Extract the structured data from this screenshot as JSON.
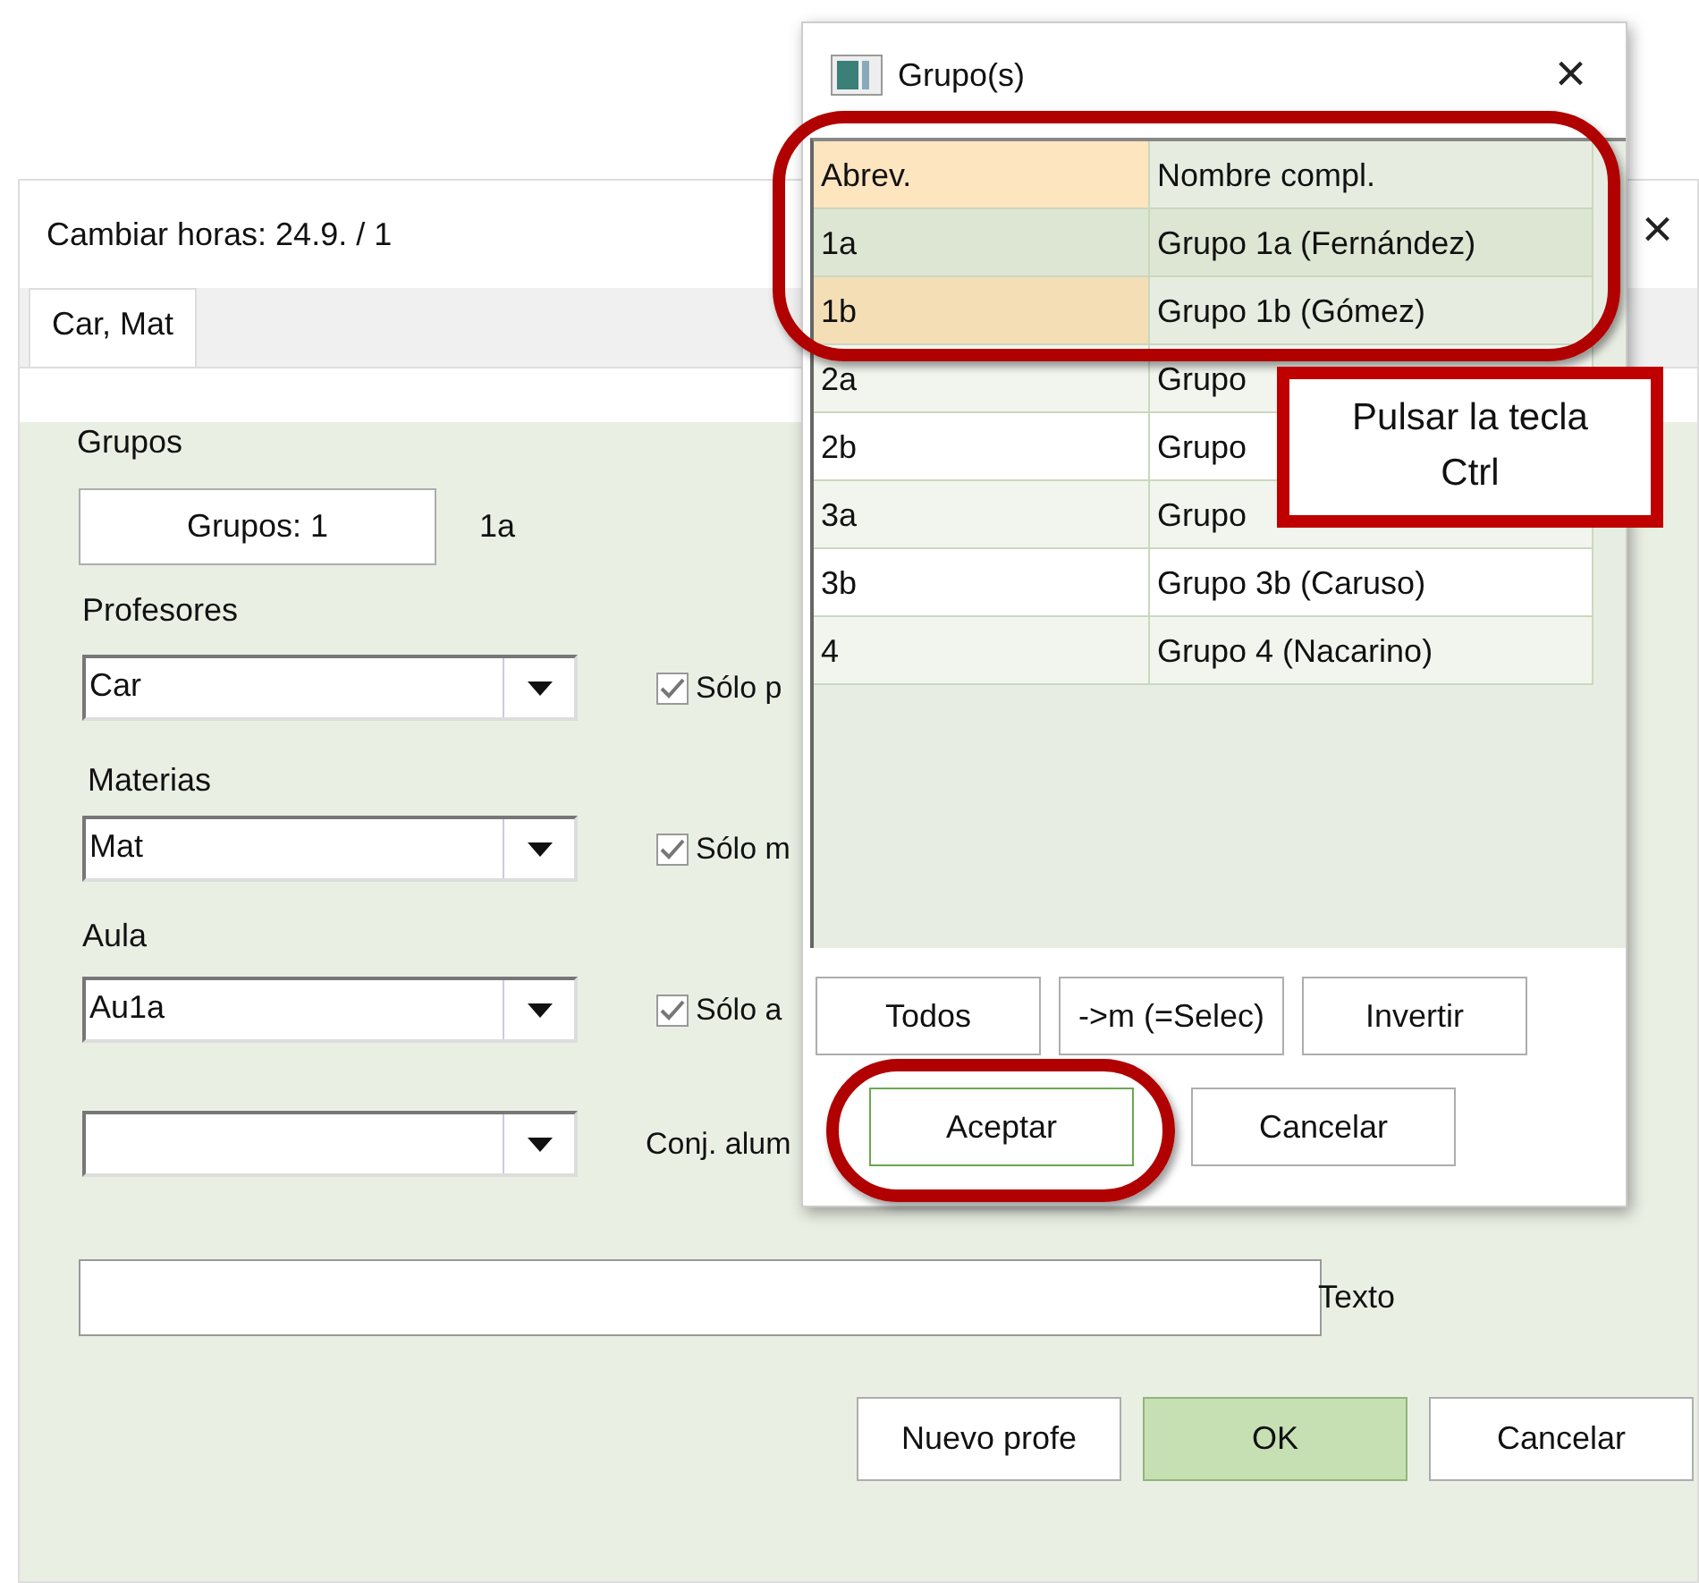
{
  "main_dialog": {
    "title": "Cambiar horas:  24.9. / 1",
    "close": "×",
    "tabs": [
      {
        "label": "Car, Mat",
        "selected": true
      }
    ],
    "groups": {
      "label": "Grupos",
      "button": "Grupos: 1",
      "value": "1a"
    },
    "fields": [
      {
        "label": "Profesores",
        "value": "Car",
        "check": {
          "label": "Sólo p",
          "checked": true
        }
      },
      {
        "label": "Materias",
        "value": "Mat",
        "check": {
          "label": "Sólo m",
          "checked": true
        }
      },
      {
        "label": "Aula",
        "value": "Au1a",
        "check": {
          "label": "Sólo a",
          "checked": true
        }
      },
      {
        "side_label": "Conj. alum"
      }
    ],
    "text_field": {
      "label": "Texto"
    },
    "buttons": [
      {
        "label": "Nuevo profe",
        "default": false
      },
      {
        "label": "OK",
        "default": true
      },
      {
        "label": "Cancelar",
        "default": false
      }
    ]
  },
  "groups_dialog": {
    "title": "Grupo(s)",
    "close": "×",
    "columns": [
      {
        "label": "Abrev.",
        "sorted": true
      },
      {
        "label": "Nombre compl.",
        "sorted": false
      }
    ],
    "rows": [
      {
        "abbr": "1a",
        "name": "Grupo 1a (Fernández)",
        "selected": true,
        "current": false
      },
      {
        "abbr": "1b",
        "name": "Grupo 1b (Gómez)",
        "selected": true,
        "current": true
      },
      {
        "abbr": "2a",
        "name": "Grupo",
        "selected": false,
        "current": false
      },
      {
        "abbr": "2b",
        "name": "Grupo",
        "selected": false,
        "current": false
      },
      {
        "abbr": "3a",
        "name": "Grupo",
        "selected": false,
        "current": false
      },
      {
        "abbr": "3b",
        "name": "Grupo 3b (Caruso)",
        "selected": false,
        "current": false
      },
      {
        "abbr": "4",
        "name": "Grupo 4 (Nacarino)",
        "selected": false,
        "current": false
      }
    ],
    "tool_buttons": [
      "Todos",
      "->m (=Selec)",
      "Invertir"
    ],
    "buttons": [
      {
        "label": "Aceptar",
        "default": true
      },
      {
        "label": "Cancelar",
        "default": false
      }
    ]
  },
  "tooltip": "Pulsar la tecla\nCtrl"
}
